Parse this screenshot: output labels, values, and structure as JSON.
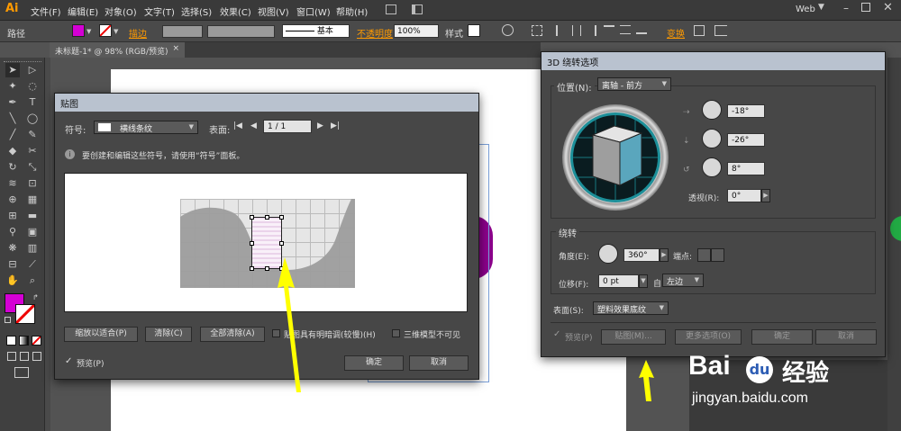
{
  "app": {
    "logo": "Ai",
    "menus": [
      "文件(F)",
      "编辑(E)",
      "对象(O)",
      "文字(T)",
      "选择(S)",
      "效果(C)",
      "视图(V)",
      "窗口(W)",
      "帮助(H)"
    ],
    "workspace": "Web"
  },
  "control_bar": {
    "object_label": "路径",
    "stroke_label": "描边",
    "line_style": "基本",
    "opacity_label": "不透明度",
    "opacity_value": "100%",
    "style_label": "样式",
    "transform_label": "变换"
  },
  "document": {
    "tab_title": "未标题-1* @ 98% (RGB/预览)",
    "tab_close": "×"
  },
  "map_art_dialog": {
    "title": "贴图",
    "symbol_label": "符号:",
    "symbol_value": "横线条纹",
    "surface_label": "表面:",
    "surface_value": "1 / 1",
    "info_text": "要创建和编辑这些符号，请使用“符号”面板。",
    "btn_scale_fit": "缩放以适合(P)",
    "btn_clear": "清除(C)",
    "btn_clear_all": "全部清除(A)",
    "chk_shade": "贴图具有明暗调(较慢)(H)",
    "chk_invisible": "三维模型不可见",
    "preview": "预览(P)",
    "ok": "确定",
    "cancel": "取消"
  },
  "rotate_dialog": {
    "title": "3D 绕转选项",
    "position_label": "位置(N):",
    "position_value": "离轴 - 前方",
    "angle_x": "-18°",
    "angle_y": "-26°",
    "angle_z": "8°",
    "perspective_label": "透视(R):",
    "perspective_value": "0°",
    "revolve_section": "绕转",
    "angle_label": "角度(E):",
    "angle_value": "360°",
    "cap_label": "端点:",
    "offset_label": "位移(F):",
    "offset_value": "0 pt",
    "from_label": "自",
    "from_value": "左边",
    "surface_label": "表面(S):",
    "surface_value": "塑料效果底纹",
    "preview": "预览(P)",
    "btn_map_art": "贴图(M)...",
    "btn_more": "更多选项(O)",
    "ok": "确定",
    "cancel": "取消"
  },
  "watermark": {
    "brand": "Bai",
    "brand_cn": "经验",
    "url": "jingyan.baidu.com"
  },
  "colors": {
    "fill": "#d400d4",
    "accent": "#ff9a00",
    "arrow": "#ffff00",
    "cube_side": "#5aa6bd",
    "dial_teal": "#1c8f99"
  }
}
